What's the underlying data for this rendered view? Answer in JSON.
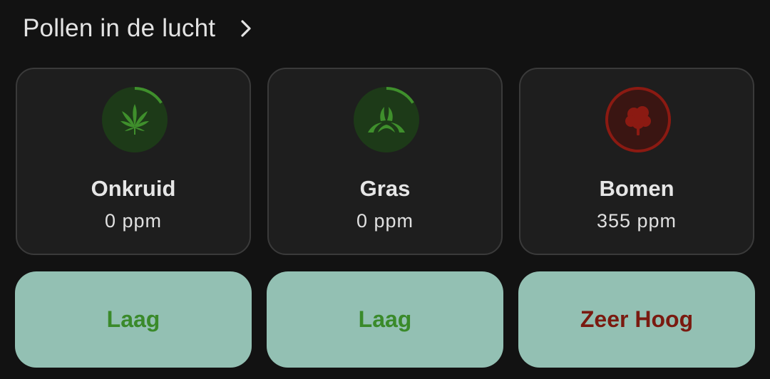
{
  "header": {
    "title": "Pollen in de lucht"
  },
  "cards": [
    {
      "name": "Onkruid",
      "value": "0 ppm",
      "icon": "cannabis-leaf-icon",
      "color": "#3f8f2c",
      "ring_fraction": 0.16
    },
    {
      "name": "Gras",
      "value": "0 ppm",
      "icon": "grass-icon",
      "color": "#3f8f2c",
      "ring_fraction": 0.16
    },
    {
      "name": "Bomen",
      "value": "355 ppm",
      "icon": "tree-icon",
      "color": "#8b1a12",
      "ring_fraction": 1.0
    }
  ],
  "levels": [
    {
      "label": "Laag",
      "color": "#3a8a2a"
    },
    {
      "label": "Laag",
      "color": "#3a8a2a"
    },
    {
      "label": "Zeer Hoog",
      "color": "#7a1a10"
    }
  ],
  "colors": {
    "background": "#121212",
    "card": "#1e1e1e",
    "level_button": "#93c0b3"
  }
}
